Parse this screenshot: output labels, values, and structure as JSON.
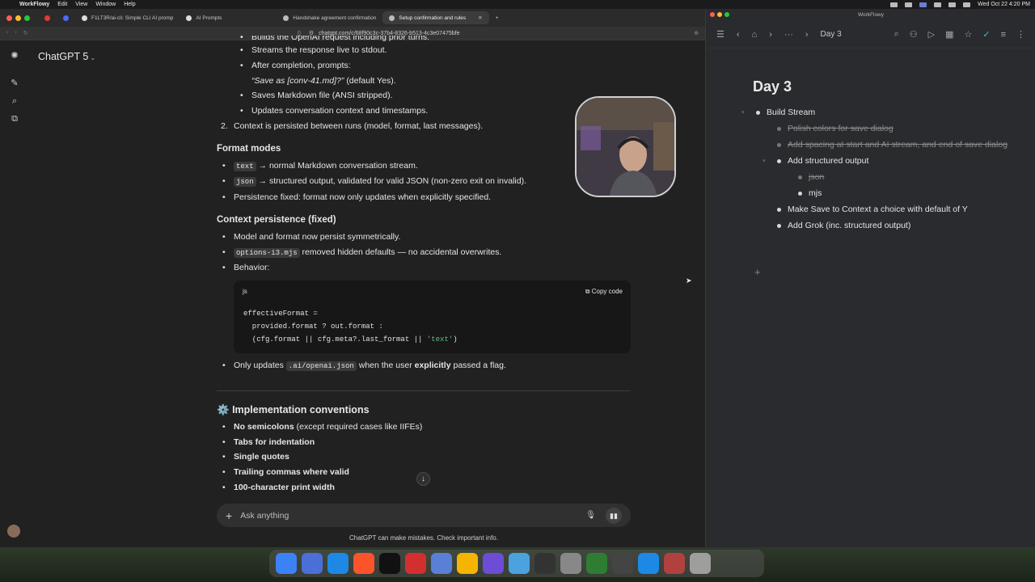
{
  "menubar": {
    "app": "WorkFlowy",
    "menus": [
      "Edit",
      "View",
      "Window",
      "Help"
    ],
    "clock": "Wed Oct 22  4:20 PM"
  },
  "browser": {
    "tabs": [
      {
        "label": ""
      },
      {
        "label": ""
      },
      {
        "label": "F1LT3R/ai-cli: Simple CLI AI promp"
      },
      {
        "label": "AI Prompts"
      },
      {
        "label": "Handshake agreement confirmation"
      },
      {
        "label": "Setup confirmation and rules"
      }
    ],
    "url": "chatgpt.com/c/68f90c3c-37b4-8326-b513-4c3e07475bfe"
  },
  "chat": {
    "model": "ChatGPT 5",
    "top_clip": "Builds the OpenAI request including prior turns.",
    "steps": [
      "Streams the response live to stdout.",
      "After completion, prompts:"
    ],
    "save_prompt": "“Save as [conv-41.md]?”",
    "save_prompt_suffix": "(default Yes).",
    "steps_after": [
      "Saves Markdown file (ANSI stripped).",
      "Updates conversation context and timestamps."
    ],
    "numbered_item": "Context is persisted between runs (model, format, last messages).",
    "format_heading": "Format modes",
    "format_text_code": "text",
    "format_text_desc": "→ normal Markdown conversation stream.",
    "format_json_code": "json",
    "format_json_desc": "→ structured output, validated for valid JSON (non-zero exit on invalid).",
    "format_persist": "Persistence fixed: format now only updates when explicitly specified.",
    "context_heading": "Context persistence (fixed)",
    "context_item1": "Model and format now persist symmetrically.",
    "context_item2_code": "options-i3.mjs",
    "context_item2_desc": "removed hidden defaults — no accidental overwrites.",
    "context_item3": "Behavior:",
    "code_lang": "js",
    "copy_label": "Copy code",
    "code_line1": "effectiveFormat =",
    "code_line2": "  provided.format ? out.format :",
    "code_line3a": "  (cfg.format || cfg.meta?.last_format || ",
    "code_line3_str": "'text'",
    "code_line3b": ")",
    "only_updates_a": "Only updates",
    "only_updates_code": ".ai/openai.json",
    "only_updates_b": "when the user",
    "only_updates_bold": "explicitly",
    "only_updates_c": "passed a flag.",
    "impl_icon": "⚙️",
    "impl_heading": "Implementation conventions",
    "no_semicolons_bold": "No semicolons",
    "no_semicolons_rest": "(except required cases like IIFEs)",
    "conventions": [
      "Tabs for indentation",
      "Single quotes",
      "Trailing commas where valid",
      "100-character print width"
    ],
    "composer_placeholder": "Ask anything",
    "disclaimer": "ChatGPT can make mistakes. Check important info."
  },
  "workflowy": {
    "window_title": "WorkFlowy",
    "breadcrumb": "Day 3",
    "page_title": "Day 3",
    "nodes": {
      "root": "Build Stream",
      "polish": "Polish colors for save dialog",
      "spacing": "Add spacing at start and AI stream, and end of save dialog",
      "structured": "Add structured output",
      "json": "json",
      "mjs": "mjs",
      "make_save": "Make Save to Context a choice with default of Y",
      "grok": "Add Grok (inc. structured output)"
    }
  },
  "colors": {
    "chat_bg": "#212121",
    "workflowy_bg": "#2a2b2e",
    "accent_check": "#3fb8d8",
    "code_string": "#5fbf87"
  }
}
